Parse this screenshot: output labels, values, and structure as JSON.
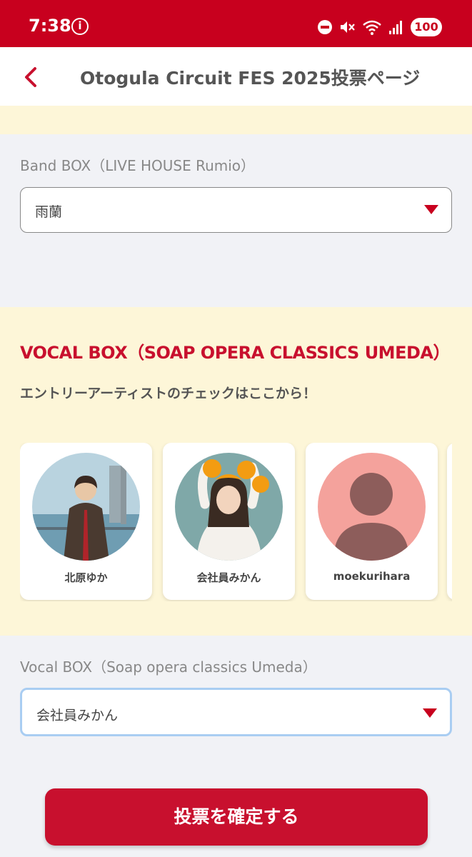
{
  "status_bar": {
    "time": "7:38",
    "info_glyph": "i",
    "battery": "100",
    "icons": [
      "info-icon",
      "dnd-icon",
      "mute-icon",
      "wifi-icon",
      "signal-icon",
      "battery-icon"
    ]
  },
  "header": {
    "back_icon": "chevron-left-icon",
    "title": "Otogula Circuit FES 2025投票ページ"
  },
  "band_box": {
    "label": "Band BOX（LIVE HOUSE Rumio）",
    "selected": "雨蘭"
  },
  "vocal_section": {
    "title": "VOCAL BOX（SOAP OPERA CLASSICS UMEDA）",
    "subtitle": "エントリーアーティストのチェックはここから！",
    "artists": [
      {
        "name": "北原ゆか",
        "photo": "artist-photo"
      },
      {
        "name": "会社員みかん",
        "photo": "artist-photo"
      },
      {
        "name": "moekurihara",
        "photo": "default-avatar-icon"
      }
    ]
  },
  "vocal_box": {
    "label": "Vocal BOX（Soap opera classics Umeda）",
    "selected": "会社員みかん"
  },
  "confirm_button": {
    "label": "投票を確定する"
  },
  "colors": {
    "brand_red": "#c8001e",
    "cream": "#fdf6d8",
    "background": "#f1f2f6",
    "focus_ring": "#a9cdf2"
  }
}
